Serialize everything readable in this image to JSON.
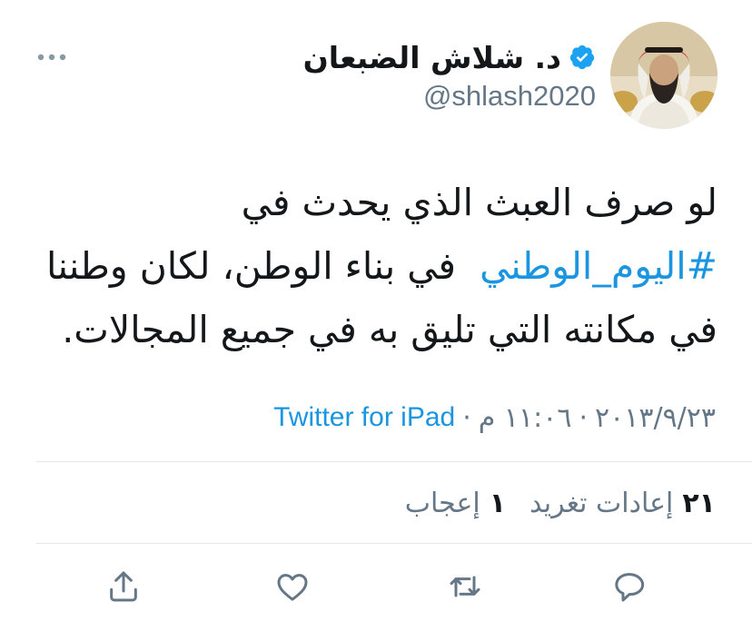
{
  "tweet": {
    "author": {
      "display_name": "د. شلاش الضبعان",
      "handle": "@shlash2020",
      "verified": true
    },
    "text": {
      "line1": "لو صرف العبث الذي يحدث في",
      "hashtag": "#اليوم_الوطني",
      "line2_rest": "في بناء الوطن، لكان وطننا",
      "line3": "في مكانته التي تليق به في جميع المجالات."
    },
    "meta": {
      "date": "٢٠١٣/٩/٢٣",
      "sep1": "·",
      "time": "١١:٠٦ م",
      "sep2": "·",
      "source": "Twitter for iPad"
    },
    "stats": {
      "retweets_count": "٢١",
      "retweets_label": "إعادات تغريد",
      "likes_count": "١",
      "likes_label": "إعجاب"
    },
    "icons": {
      "verified": "verified-badge-icon",
      "more": "more-dots-icon",
      "reply": "reply-icon",
      "retweet": "retweet-icon",
      "like": "heart-icon",
      "share": "share-icon"
    },
    "colors": {
      "accent": "#1b95e0",
      "verified": "#1da1f2",
      "secondary_text": "#657786",
      "primary_text": "#14171a",
      "divider": "#e1e8ed"
    }
  }
}
